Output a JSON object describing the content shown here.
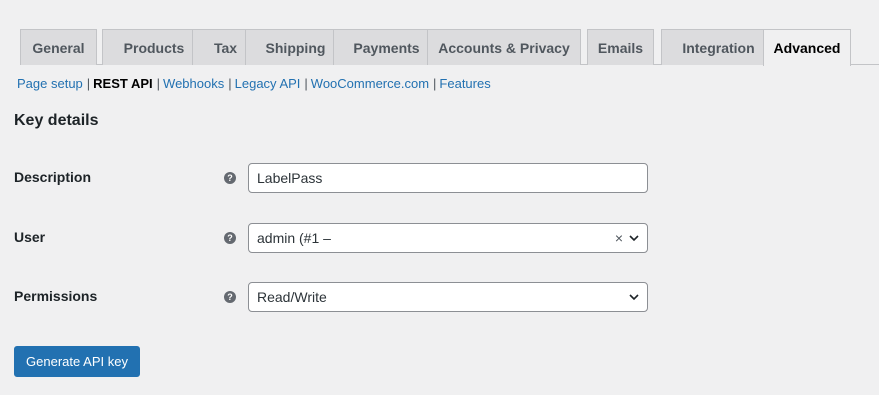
{
  "tabs": [
    {
      "label": "General"
    },
    {
      "label": "Products"
    },
    {
      "label": "Tax"
    },
    {
      "label": "Shipping"
    },
    {
      "label": "Payments"
    },
    {
      "label": "Accounts & Privacy"
    },
    {
      "label": "Emails"
    },
    {
      "label": "Integration"
    },
    {
      "label": "Advanced",
      "active": true
    }
  ],
  "subnav": [
    {
      "label": "Page setup"
    },
    {
      "label": "REST API",
      "current": true
    },
    {
      "label": "Webhooks"
    },
    {
      "label": "Legacy API"
    },
    {
      "label": "WooCommerce.com"
    },
    {
      "label": "Features"
    }
  ],
  "section_title": "Key details",
  "form": {
    "description": {
      "label": "Description",
      "value": "LabelPass"
    },
    "user": {
      "label": "User",
      "value": "admin (#1 –"
    },
    "permissions": {
      "label": "Permissions",
      "value": "Read/Write"
    }
  },
  "help_glyph": "?",
  "clear_glyph": "×",
  "generate_button": "Generate API key",
  "colors": {
    "accent": "#2271b1",
    "tab_bg": "#dcdcde",
    "page_bg": "#f0f0f1"
  }
}
